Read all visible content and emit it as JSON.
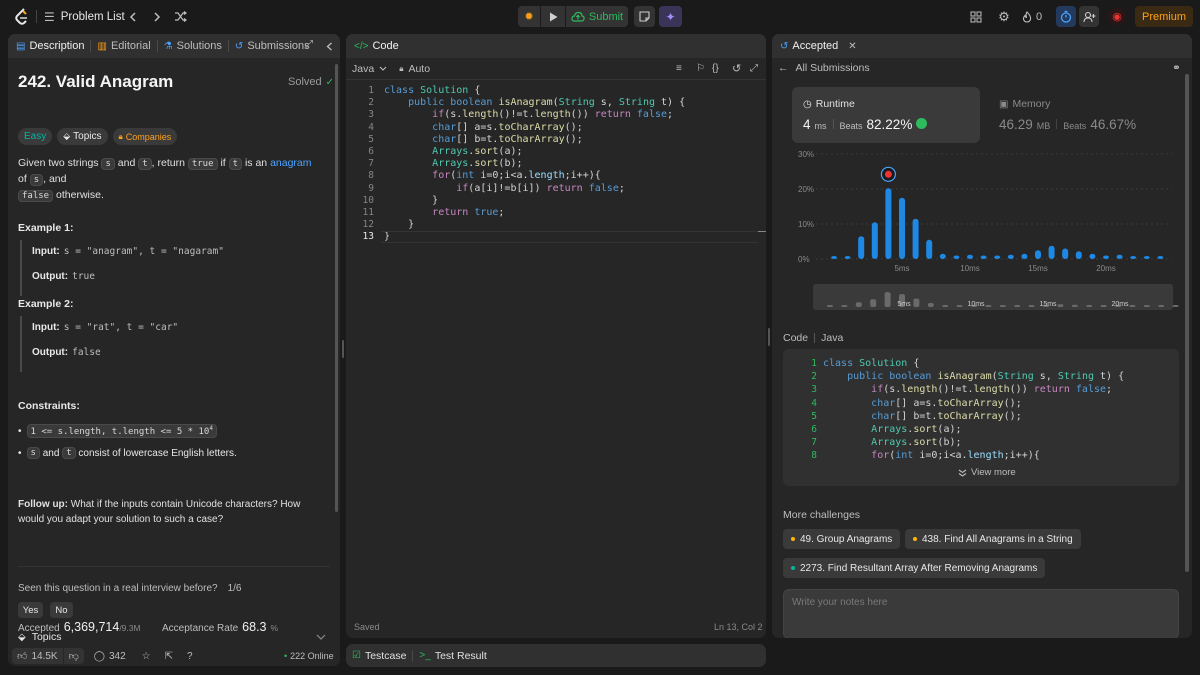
{
  "topbar": {
    "problem_list": "Problem List",
    "submit": "Submit",
    "streak": "0",
    "premium": "Premium"
  },
  "left": {
    "tabs": [
      "Description",
      "Editorial",
      "Solutions",
      "Submissions"
    ],
    "title": "242. Valid Anagram",
    "solved": "Solved",
    "difficulty": "Easy",
    "topics": "Topics",
    "companies": "Companies",
    "desc": {
      "p1": "Given two strings ",
      "s": "s",
      "and": " and ",
      "t": "t",
      "p2": ", return ",
      "true": "true",
      "if": " if ",
      "is_an": " is an ",
      "anagram": "anagram",
      "of": " of ",
      "comma_and": ", and",
      "false": "false",
      "otherwise": " otherwise."
    },
    "example1": {
      "title": "Example 1:",
      "input_label": "Input:",
      "input": "s = \"anagram\", t = \"nagaram\"",
      "output_label": "Output:",
      "output": "true"
    },
    "example2": {
      "title": "Example 2:",
      "input_label": "Input:",
      "input": "s = \"rat\", t = \"car\"",
      "output_label": "Output:",
      "output": "false"
    },
    "constraints_title": "Constraints:",
    "constraint1": "1 <= s.length, t.length <= 5 * 10",
    "constraint1_exp": "4",
    "constraint2_s": "s",
    "constraint2_and": " and ",
    "constraint2_t": "t",
    "constraint2_rest": " consist of lowercase English letters.",
    "followup_label": "Follow up:",
    "followup": " What if the inputs contain Unicode characters? How would you adapt your solution to such a case?",
    "seen": "Seen this question in a real interview before?",
    "seen_count": "1/6",
    "yes": "Yes",
    "no": "No",
    "accepted_label": "Accepted",
    "accepted_value": "6,369,714",
    "accepted_total": "/9.3M",
    "rate_label": "Acceptance Rate",
    "rate_value": "68.3",
    "rate_unit": "%",
    "topics_row": "Topics",
    "likes": "14.5K",
    "comments": "342",
    "online": "222 Online"
  },
  "editor": {
    "tab": "Code",
    "language": "Java",
    "auto": "Auto",
    "saved": "Saved",
    "cursor": "Ln 13, Col 2",
    "testcase": "Testcase",
    "test_result": "Test Result"
  },
  "right": {
    "tab": "Accepted",
    "all_submissions": "All Submissions",
    "runtime_label": "Runtime",
    "runtime_value": "4",
    "runtime_unit": "ms",
    "beats_label": "Beats",
    "runtime_beats": "82.22%",
    "memory_label": "Memory",
    "memory_value": "46.29",
    "memory_unit": "MB",
    "memory_beats": "46.67%",
    "code_label": "Code",
    "code_lang": "Java",
    "view_more": "View more",
    "more_challenges": "More challenges",
    "challenges": [
      {
        "text": "49. Group Anagrams",
        "color": "#ffb800"
      },
      {
        "text": "438. Find All Anagrams in a String",
        "color": "#ffb800"
      },
      {
        "text": "2273. Find Resultant Array After Removing Anagrams",
        "color": "#00b8a3"
      }
    ],
    "notes_placeholder": "Write your notes here"
  },
  "chart_data": {
    "type": "bar",
    "ytick_labels": [
      "30%",
      "20%",
      "10%",
      "0%"
    ],
    "ylim": [
      0,
      30
    ],
    "xtick_labels": [
      "5ms",
      "10ms",
      "15ms",
      "20ms"
    ],
    "xtick_ms": [
      5,
      10,
      15,
      20
    ],
    "x_ms": [
      0,
      1,
      2,
      3,
      4,
      5,
      6,
      7,
      8,
      9,
      10,
      11,
      12,
      13,
      14,
      15,
      16,
      17,
      18,
      19,
      20,
      21,
      22,
      23,
      24
    ],
    "values": [
      0.8,
      0.8,
      6.5,
      10.5,
      20.2,
      17.5,
      11.5,
      5.5,
      1.5,
      1.0,
      1.2,
      1.0,
      1.0,
      1.2,
      1.5,
      2.5,
      3.8,
      3.0,
      2.2,
      1.5,
      1.0,
      1.2,
      0.8,
      0.8,
      0.8
    ],
    "highlight_ms": 4
  }
}
